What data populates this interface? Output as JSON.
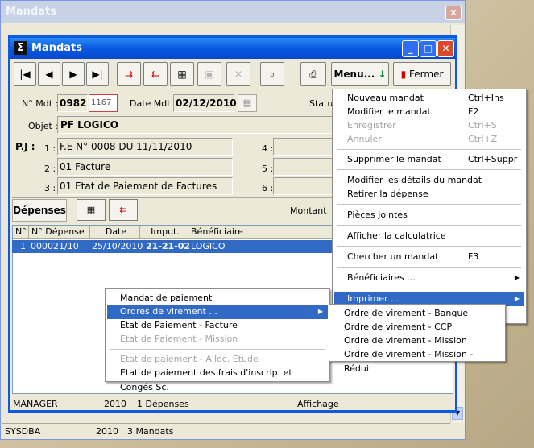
{
  "outer": {
    "title": "Mandats",
    "close": "✕",
    "status": [
      "SYSDBA",
      "2010",
      "3 Mandats"
    ]
  },
  "inner": {
    "title": "Mandats",
    "sys_icon": "Σ",
    "toolbar": {
      "menu_label": "Menu...",
      "close_label": "Fermer"
    },
    "fields": {
      "mdt_label": "N° Mdt :",
      "mdt_num": "0982",
      "mdt_alt": "1167",
      "date_label": "Date Mdt :",
      "date_value": "02/12/2010",
      "statut_label": "Statu",
      "objet_label": "Objet :",
      "objet_value": "PF LOGICO",
      "pj_label": "P.J :",
      "pj": [
        {
          "n": "1 :",
          "v": "F.E N° 0008 DU 11/11/2010"
        },
        {
          "n": "2 :",
          "v": "01 Facture"
        },
        {
          "n": "3 :",
          "v": "01 Etat de Paiement de Factures"
        }
      ],
      "pj_right": [
        "4 :",
        "5 :",
        "6 :"
      ]
    },
    "depenses": {
      "tab": "Dépenses",
      "montant_label": "Montant",
      "columns": [
        "N°",
        "N° Dépense",
        "Date",
        "Imput.",
        "Bénéficiaire"
      ],
      "rows": [
        {
          "n": "1",
          "dep": "000021/10",
          "date": "25/10/2010",
          "imput": "21-21-02",
          "benef": "LOGICO"
        }
      ]
    },
    "status": [
      "MANAGER",
      "2010",
      "1 Dépenses",
      "Affichage"
    ]
  },
  "main_menu": [
    {
      "label": "Nouveau mandat",
      "shortcut": "Ctrl+Ins"
    },
    {
      "label": "Modifier le mandat",
      "shortcut": "F2"
    },
    {
      "label": "Enregistrer",
      "shortcut": "Ctrl+S",
      "disabled": true
    },
    {
      "label": "Annuler",
      "shortcut": "Ctrl+Z",
      "disabled": true
    },
    {
      "label": "Supprimer le mandat",
      "shortcut": "Ctrl+Suppr"
    },
    {
      "label": "Modifier les détails du mandat",
      "shortcut": ""
    },
    {
      "label": "Retirer la dépense",
      "shortcut": ""
    },
    {
      "label": "Pièces jointes",
      "shortcut": ""
    },
    {
      "label": "Afficher la calculatrice",
      "shortcut": ""
    },
    {
      "label": "Chercher un mandat",
      "shortcut": "F3"
    },
    {
      "label": "Bénéficiaires ...",
      "shortcut": ""
    },
    {
      "label": "Imprimer ...",
      "shortcut": ""
    }
  ],
  "print_menu": [
    {
      "label": "Mandat de paiement"
    },
    {
      "label": "Ordres de virement ..."
    },
    {
      "label": "Etat de Paiement - Facture"
    },
    {
      "label": "Etat de Paiement - Mission",
      "disabled": true
    },
    {
      "label": "Etat de paiement - Alloc. Etude",
      "disabled": true
    },
    {
      "label": "Etat de paiement des frais d'inscrip. et Congés Sc."
    }
  ],
  "virement_menu": [
    {
      "label": "Ordre de virement - Banque"
    },
    {
      "label": "Ordre de virement - CCP"
    },
    {
      "label": "Ordre de virement - Mission"
    },
    {
      "label": "Ordre de virement - Mission - Réduit"
    }
  ],
  "colors": {
    "title_blue": "#0a58e0",
    "highlight": "#316ac5"
  }
}
